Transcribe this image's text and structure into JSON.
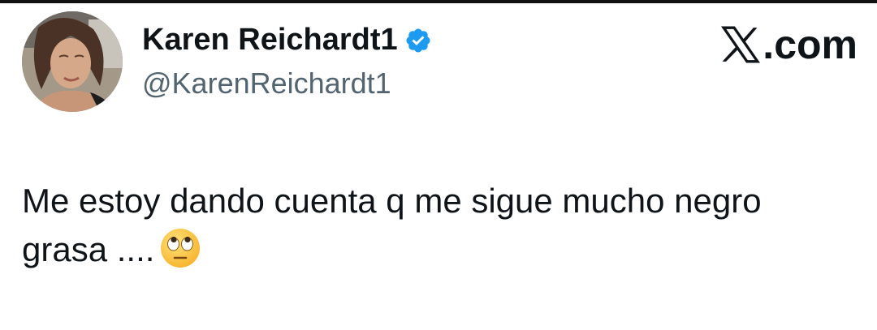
{
  "tweet": {
    "display_name": "Karen Reichardt1",
    "handle": "@KarenReichardt1",
    "verified": true,
    "text_line_1": "Me estoy dando cuenta q me sigue mucho negro",
    "text_line_2": "grasa ....",
    "emoji": "face-with-rolling-eyes-icon"
  },
  "brand": {
    "suffix": ".com"
  },
  "colors": {
    "text": "#0f1419",
    "secondary": "#536471",
    "verified_badge": "#1d9bf0"
  }
}
